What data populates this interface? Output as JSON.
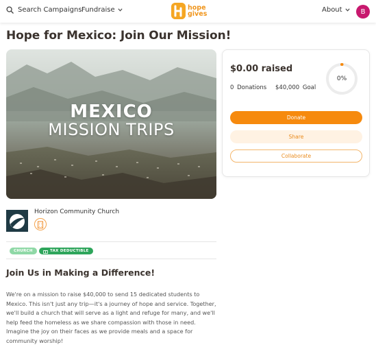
{
  "header": {
    "search_label": "Search Campaigns",
    "fundraise_label": "Fundraise",
    "logo_text_line1": "hope",
    "logo_text_line2": "gives",
    "about_label": "About",
    "avatar_initial": "B",
    "icons": {
      "search": "search-icon",
      "chevron": "chevron-down-icon"
    }
  },
  "campaign": {
    "title": "Hope for Mexico: Join Our Mission!",
    "hero_line1": "MEXICO",
    "hero_line2": "MISSION TRIPS"
  },
  "donation_card": {
    "raised": "$0.00 raised",
    "donations_count": "0",
    "donations_label": "Donations",
    "goal_amount": "$40,000",
    "goal_label": "Goal",
    "progress_percent_label": "0%",
    "progress_fraction": 0,
    "buttons": {
      "donate": "Donate",
      "share": "Share",
      "collaborate": "Collaborate"
    }
  },
  "organizer": {
    "name": "Horizon Community Church",
    "icon": "building-icon"
  },
  "badges": {
    "church": "CHURCH",
    "tax_deductible": "TAX DEDUCTIBLE"
  },
  "story": {
    "heading": "Join Us in Making a Difference!",
    "body": "We're on a mission to raise $40,000 to send 15 dedicated students to Mexico. This isn't just any trip—it's a journey of hope and service. Together, we'll build a church that will serve as a light and refuge for many, and we'll help feed the homeless as we share compassion with those in need. Imagine the joy on their faces as we provide meals and a space for community worship!"
  },
  "colors": {
    "brand_orange": "#f68a0e",
    "share_bg": "#fff2e3",
    "avatar": "#c8186e",
    "badge_church": "#8fd8a6",
    "badge_tax": "#2ea55b"
  }
}
